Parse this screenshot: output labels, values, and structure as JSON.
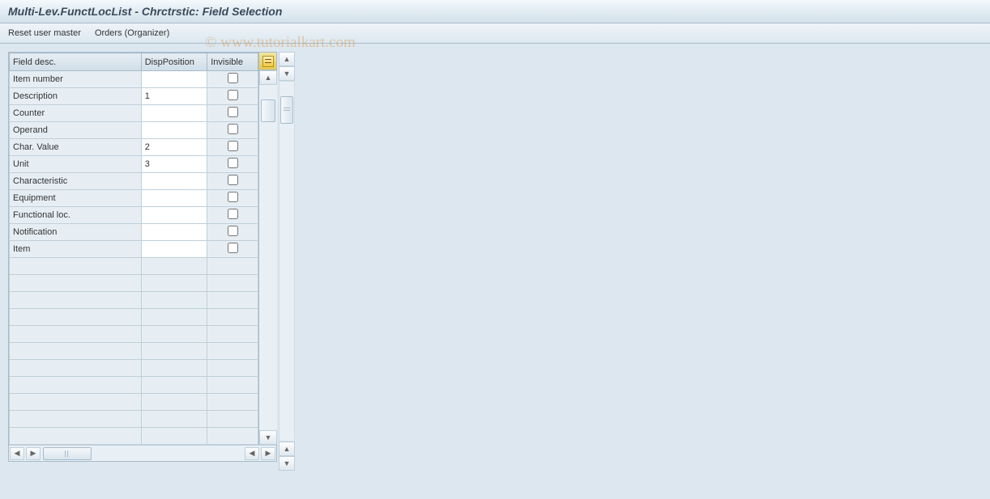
{
  "title": "Multi-Lev.FunctLocList - Chrctrstic: Field Selection",
  "toolbar": {
    "reset": "Reset user master",
    "orders": "Orders (Organizer)"
  },
  "watermark": "© www.tutorialkart.com",
  "columns": {
    "field": "Field desc.",
    "pos": "DispPosition",
    "inv": "Invisible"
  },
  "rows": [
    {
      "field": "Item number",
      "pos": "",
      "inv": false
    },
    {
      "field": "Description",
      "pos": "1",
      "inv": false
    },
    {
      "field": "Counter",
      "pos": "",
      "inv": false
    },
    {
      "field": "Operand",
      "pos": "",
      "inv": false
    },
    {
      "field": "Char. Value",
      "pos": "2",
      "inv": false
    },
    {
      "field": "Unit",
      "pos": "3",
      "inv": false
    },
    {
      "field": "Characteristic",
      "pos": "",
      "inv": false
    },
    {
      "field": "Equipment",
      "pos": "",
      "inv": false
    },
    {
      "field": "Functional loc.",
      "pos": "",
      "inv": false
    },
    {
      "field": "Notification",
      "pos": "",
      "inv": false
    },
    {
      "field": "Item",
      "pos": "",
      "inv": false
    }
  ],
  "emptyRows": 11
}
